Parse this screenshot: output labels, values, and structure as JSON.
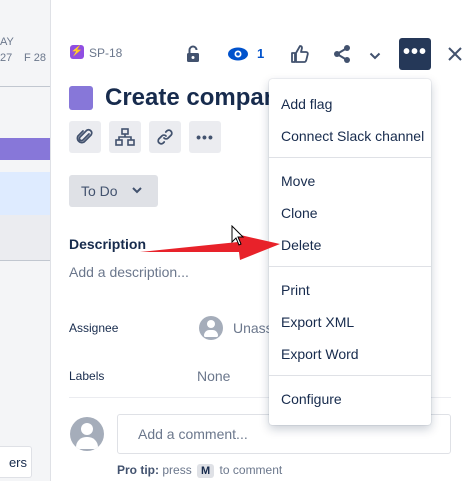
{
  "board": {
    "day_header": "AY",
    "day_left": "27",
    "day_right": "F 28",
    "cut_button_label": "ers"
  },
  "issue": {
    "key": "SP-18",
    "type_icon": "bolt-icon",
    "title": "Create company",
    "watch_count": "1",
    "status": "To Do"
  },
  "header_icons": [
    "lock-icon",
    "eye-icon",
    "thumbs-up-icon",
    "share-icon",
    "chevron-down-icon",
    "more-icon",
    "close-icon"
  ],
  "tools": [
    "attachment-icon",
    "child-issues-icon",
    "link-icon",
    "more-icon"
  ],
  "description": {
    "label": "Description",
    "placeholder": "Add a description..."
  },
  "fields": {
    "assignee_label": "Assignee",
    "assignee_value": "Unass",
    "labels_label": "Labels",
    "labels_value": "None"
  },
  "comment": {
    "placeholder": "Add a comment...",
    "pro_tip_strong": "Pro tip:",
    "pro_tip_pre": "press",
    "pro_tip_key": "M",
    "pro_tip_post": "to comment"
  },
  "menu": {
    "groups": [
      [
        "Add flag",
        "Connect Slack channel"
      ],
      [
        "Move",
        "Clone",
        "Delete"
      ],
      [
        "Print",
        "Export XML",
        "Export Word"
      ],
      [
        "Configure"
      ]
    ]
  },
  "colors": {
    "accent_purple": "#8777d9",
    "more_button": "#253858",
    "watch_blue": "#0052cc",
    "annotation_red": "#e8222a"
  }
}
